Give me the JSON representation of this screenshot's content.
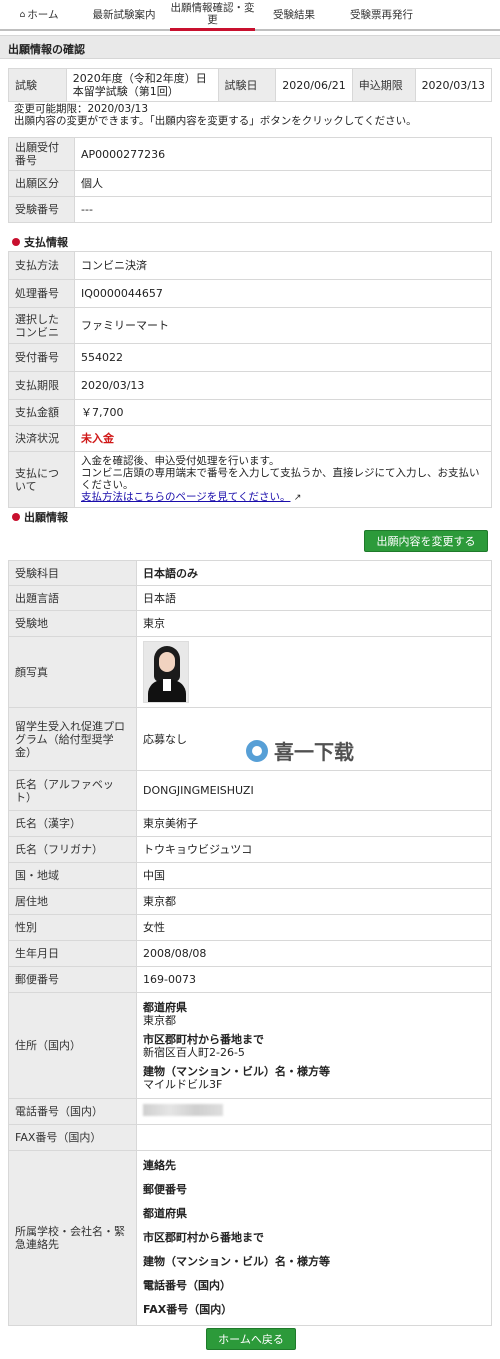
{
  "nav": {
    "home": "ホーム",
    "latest": "最新試験案内",
    "confirm": "出願情報確認・変更",
    "result": "受験結果",
    "reissue": "受験票再発行"
  },
  "page_title": "出願情報の確認",
  "exam_table": {
    "exam_label": "試験",
    "exam_value": "2020年度（令和2年度）日本留学試験（第1回）",
    "date_label": "試験日",
    "date_value": "2020/06/21",
    "deadline_label": "申込期限",
    "deadline_value": "2020/03/13"
  },
  "notice": {
    "line1": "変更可能期限：2020/03/13",
    "line2": "出願内容の変更ができます。「出願内容を変更する」ボタンをクリックしてください。"
  },
  "app_info": {
    "receipt_no_label": "出願受付番号",
    "receipt_no": "AP0000277236",
    "type_label": "出願区分",
    "type": "個人",
    "exam_no_label": "受験番号",
    "exam_no": "---"
  },
  "payment": {
    "heading": "支払情報",
    "method_label": "支払方法",
    "method": "コンビニ決済",
    "process_no_label": "処理番号",
    "process_no": "IQ0000044657",
    "store_label": "選択したコンビニ",
    "store": "ファミリーマート",
    "receipt_label": "受付番号",
    "receipt": "554022",
    "deadline_label": "支払期限",
    "deadline": "2020/03/13",
    "amount_label": "支払金額",
    "amount": "￥7,700",
    "status_label": "決済状況",
    "status": "未入金",
    "about_label": "支払について",
    "about_line1": "入金を確認後、申込受付処理を行います。",
    "about_line2": "コンビニ店頭の専用端末で番号を入力して支払うか、直接レジにて入力し、お支払いください。",
    "about_link": "支払方法はこちらのページを見てください。"
  },
  "application": {
    "heading": "出願情報",
    "change_button": "出願内容を変更する",
    "subject_label": "受験科目",
    "subject": "日本語のみ",
    "lang_label": "出題言語",
    "lang": "日本語",
    "site_label": "受験地",
    "site": "東京",
    "photo_label": "顔写真",
    "scholarship_label": "留学生受入れ促進プログラム（給付型奨学金）",
    "scholarship": "応募なし",
    "name_alpha_label": "氏名（アルファベット）",
    "name_alpha": "DONGJINGMEISHUZI",
    "name_kanji_label": "氏名（漢字）",
    "name_kanji": "東京美術子",
    "name_kana_label": "氏名（フリガナ）",
    "name_kana": "トウキョウビジュツコ",
    "country_label": "国・地域",
    "country": "中国",
    "residence_label": "居住地",
    "residence": "東京都",
    "gender_label": "性別",
    "gender": "女性",
    "birth_label": "生年月日",
    "birth": "2008/08/08",
    "postal_label": "郵便番号",
    "postal": "169-0073",
    "address_label": "住所（国内）",
    "addr_pref_h": "都道府県",
    "addr_pref": "東京都",
    "addr_city_h": "市区郡町村から番地まで",
    "addr_city": "新宿区百人町2-26-5",
    "addr_bldg_h": "建物（マンション・ビル）名・様方等",
    "addr_bldg": "マイルドビル3F",
    "phone_label": "電話番号（国内）",
    "fax_label": "FAX番号（国内）",
    "school_label": "所属学校・会社名・緊急連絡先",
    "school_contact": "連絡先",
    "school_postal": "郵便番号",
    "school_pref": "都道府県",
    "school_city": "市区郡町村から番地まで",
    "school_bldg": "建物（マンション・ビル）名・様方等",
    "school_phone": "電話番号（国内）",
    "school_fax": "FAX番号（国内）"
  },
  "home_button": "ホームへ戻る",
  "watermark": "喜一下载",
  "colors": {
    "accent_red": "#c8102e",
    "button_green": "#2c9a3a",
    "label_bg": "#ececec"
  }
}
